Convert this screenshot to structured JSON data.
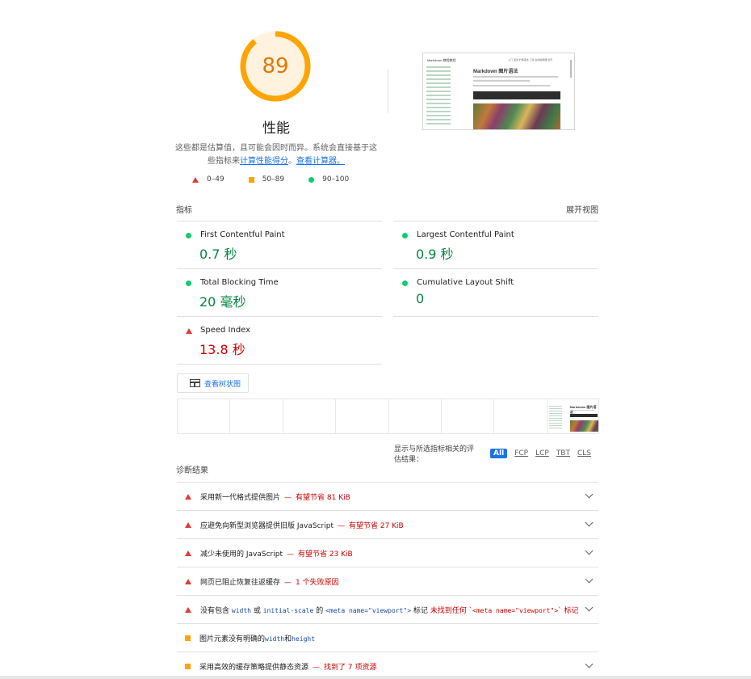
{
  "score": {
    "value": "89",
    "fraction": 0.89,
    "label": "性能",
    "color": "#ffa400"
  },
  "description": {
    "text": "这些都是估算值，且可能会因时而异。系统会直接基于这些指标来",
    "link1": "计算性能得分",
    "mid": "。",
    "link2": "查看计算器。"
  },
  "legend": [
    {
      "icon": "fail-triangle",
      "range": "0–49"
    },
    {
      "icon": "average-square",
      "range": "50–89"
    },
    {
      "icon": "pass-circle",
      "range": "90–100"
    }
  ],
  "screenshot": {
    "title": "Markdown 图片语法",
    "brand": "Markdown 教程教程",
    "nav": "入门  语法  扩展语法  工具  在线编辑器  资讯"
  },
  "metrics": {
    "header": "指标",
    "toggle": "展开视图",
    "items": [
      {
        "name": "First Contentful Paint",
        "value": "0.7 秒",
        "status": "pass"
      },
      {
        "name": "Largest Contentful Paint",
        "value": "0.9 秒",
        "status": "pass"
      },
      {
        "name": "Total Blocking Time",
        "value": "20 毫秒",
        "status": "pass"
      },
      {
        "name": "Cumulative Layout Shift",
        "value": "0",
        "status": "pass"
      },
      {
        "name": "Speed Index",
        "value": "13.8 秒",
        "status": "fail"
      }
    ]
  },
  "treemap_button": "查看树状图",
  "filmstrip": {
    "frame_count": 8,
    "loaded_from": 7
  },
  "filter": {
    "label": "显示与所选指标相关的评估结果：",
    "options": [
      "All",
      "FCP",
      "LCP",
      "TBT",
      "CLS"
    ],
    "active": "All"
  },
  "diagnostics": {
    "header": "诊断结果",
    "items": [
      {
        "icon": "fail-triangle",
        "title": "采用新一代格式提供图片",
        "sep": "—",
        "savings": "有望节省 81 KiB"
      },
      {
        "icon": "fail-triangle",
        "title": "应避免向新型浏览器提供旧版 JavaScript",
        "sep": "—",
        "savings": "有望节省 27 KiB"
      },
      {
        "icon": "fail-triangle",
        "title": "减少未使用的 JavaScript",
        "sep": "—",
        "savings": "有望节省 23 KiB"
      },
      {
        "icon": "fail-triangle",
        "title": "网页已阻止恢复往返缓存",
        "sep": "—",
        "savings": "1 个失败原因"
      },
      {
        "icon": "fail-triangle",
        "title_parts": [
          "没有包含 ",
          "width",
          " 或 ",
          "initial-scale",
          " 的 ",
          "<meta name=\"viewport\">",
          " 标记"
        ],
        "savings_parts": [
          "未找到任何 `",
          "<meta name=\"viewport\">",
          "` 标记"
        ]
      },
      {
        "icon": "average-square",
        "title_parts": [
          "图片元素没有明确的",
          "width",
          "和",
          "height"
        ]
      },
      {
        "icon": "average-square",
        "title": "采用高效的缓存策略提供静态资源",
        "sep": "—",
        "savings": "找到了 7 项资源"
      }
    ]
  }
}
